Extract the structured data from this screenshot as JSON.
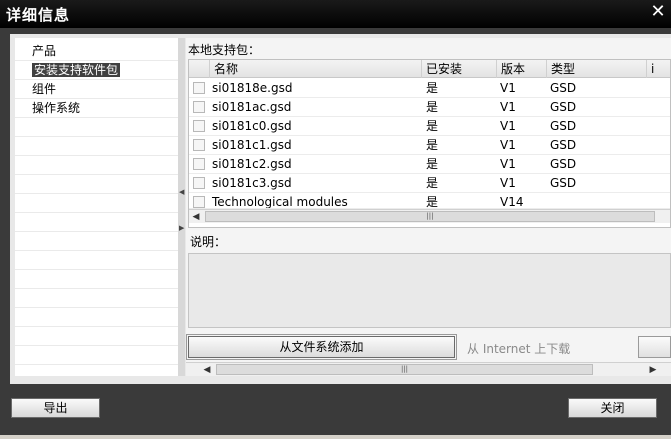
{
  "window": {
    "title": "详细信息"
  },
  "left_nav": {
    "items": [
      {
        "label": "产品"
      },
      {
        "label": "安装支持软件包"
      },
      {
        "label": "组件"
      },
      {
        "label": "操作系统"
      }
    ],
    "selected_index": 1
  },
  "support_packages": {
    "label": "本地支持包：",
    "columns": [
      "名称",
      "已安装",
      "版本",
      "类型",
      "i"
    ],
    "rows": [
      {
        "name": "si01818e.gsd",
        "installed": "是",
        "version": "V1",
        "type": "GSD"
      },
      {
        "name": "si0181ac.gsd",
        "installed": "是",
        "version": "V1",
        "type": "GSD"
      },
      {
        "name": "si0181c0.gsd",
        "installed": "是",
        "version": "V1",
        "type": "GSD"
      },
      {
        "name": "si0181c1.gsd",
        "installed": "是",
        "version": "V1",
        "type": "GSD"
      },
      {
        "name": "si0181c2.gsd",
        "installed": "是",
        "version": "V1",
        "type": "GSD"
      },
      {
        "name": "si0181c3.gsd",
        "installed": "是",
        "version": "V1",
        "type": "GSD"
      },
      {
        "name": "Technological modules",
        "installed": "是",
        "version": "V14",
        "type": ""
      }
    ]
  },
  "description": {
    "label": "说明："
  },
  "actions": {
    "add_from_fs": "从文件系统添加",
    "download_internet": "从 Internet 上下载"
  },
  "footer": {
    "export": "导出",
    "close": "关闭"
  },
  "icons": {
    "close": "close-icon",
    "scroll_left": "chevron-left-icon",
    "scroll_right": "chevron-right-icon",
    "collapse": "triangle-icon"
  }
}
